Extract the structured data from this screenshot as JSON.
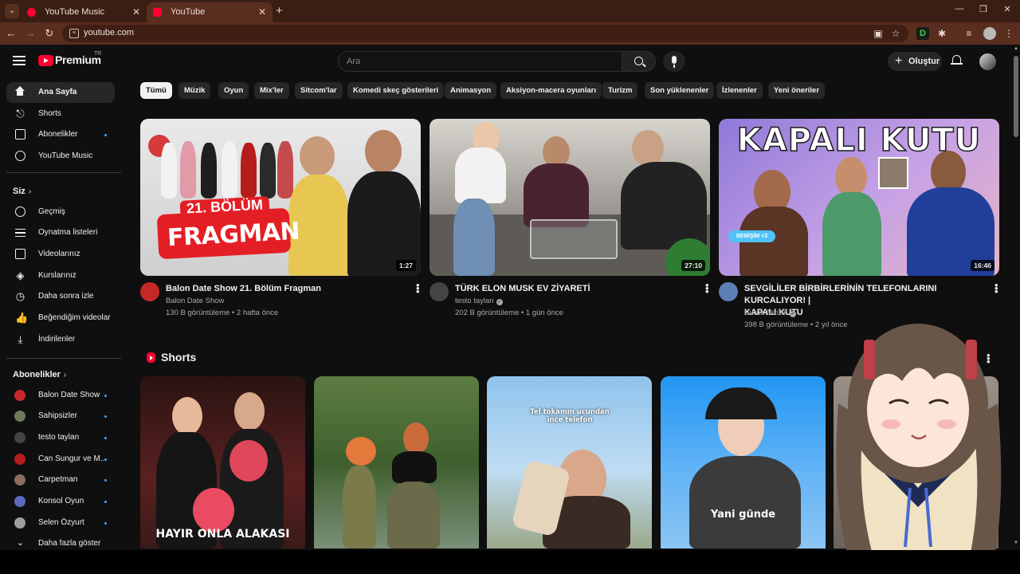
{
  "browser": {
    "tabs": [
      {
        "title": "YouTube Music",
        "active": false
      },
      {
        "title": "YouTube",
        "active": true
      }
    ],
    "url": "youtube.com"
  },
  "header": {
    "logo_text": "Premium",
    "logo_region": "TR",
    "search_placeholder": "Ara",
    "create_label": "Oluştur"
  },
  "sidebar": {
    "main": [
      {
        "label": "Ana Sayfa",
        "icon": "home-icon",
        "active": true
      },
      {
        "label": "Shorts",
        "icon": "shorts-icon"
      },
      {
        "label": "Abonelikler",
        "icon": "subscriptions-icon",
        "dot": true
      },
      {
        "label": "YouTube Music",
        "icon": "youtube-music-icon"
      }
    ],
    "you_section": "Siz",
    "you": [
      {
        "label": "Geçmiş",
        "icon": "history-icon"
      },
      {
        "label": "Oynatma listeleri",
        "icon": "playlists-icon"
      },
      {
        "label": "Videolarınız",
        "icon": "your-videos-icon"
      },
      {
        "label": "Kurslarınız",
        "icon": "courses-icon"
      },
      {
        "label": "Daha sonra izle",
        "icon": "watch-later-icon"
      },
      {
        "label": "Beğendiğim videolar",
        "icon": "liked-videos-icon"
      },
      {
        "label": "İndirilenler",
        "icon": "downloads-icon"
      }
    ],
    "subs_section": "Abonelikler",
    "subs": [
      {
        "label": "Balon Date Show",
        "color": "#c62828"
      },
      {
        "label": "Sahipsizler",
        "color": "#6d7b5a"
      },
      {
        "label": "testo taylan",
        "color": "#444444"
      },
      {
        "label": "Can Sungur ve M...",
        "color": "#b71c1c"
      },
      {
        "label": "Carpetman",
        "color": "#8d6e63"
      },
      {
        "label": "Konsol Oyun",
        "color": "#5c6bc0"
      },
      {
        "label": "Selen Özyurt",
        "color": "#9e9e9e"
      }
    ],
    "show_more": "Daha fazla göster"
  },
  "chips": [
    "Tümü",
    "Müzik",
    "Oyun",
    "Mix'ler",
    "Sitcom'lar",
    "Komedi skeç gösterileri",
    "Animasyon",
    "Aksiyon-macera oyunları",
    "Turizm",
    "Son yüklenenler",
    "İzlenenler",
    "Yeni öneriler"
  ],
  "videos": [
    {
      "title": "Balon Date Show 21. Bölüm Fragman",
      "channel": "Balon Date Show",
      "verified": false,
      "views": "130 B görüntüleme",
      "age": "2 hafta önce",
      "duration": "1:27",
      "thumb_top": "21. BÖLÜM",
      "thumb_main": "FRAGMAN"
    },
    {
      "title": "TÜRK ELON MUSK EV ZİYARETİ",
      "channel": "testo taylan",
      "verified": true,
      "views": "202 B görüntüleme",
      "age": "1 gün önce",
      "duration": "27:10"
    },
    {
      "title_line1": "SEVGİLİLER BİRBİRLERİNİN TELEFONLARINI KURCALIYOR! |",
      "title_line2": "KAPALI KUTU",
      "channel": "Burak Aktürk",
      "verified": true,
      "views": "398 B görüntüleme",
      "age": "2 yıl önce",
      "duration": "16:46",
      "thumb_text": "KAPALI KUTU",
      "thumb_badge": "BEBİŞİM <3"
    }
  ],
  "shorts": {
    "title": "Shorts",
    "items": [
      {
        "caption": "HAYIR ONLA ALAKASI"
      },
      {
        "caption": ""
      },
      {
        "caption": "Tel tokamın ucundan ince telefon"
      },
      {
        "caption": "Yani günde"
      },
      {
        "caption": ""
      }
    ]
  }
}
